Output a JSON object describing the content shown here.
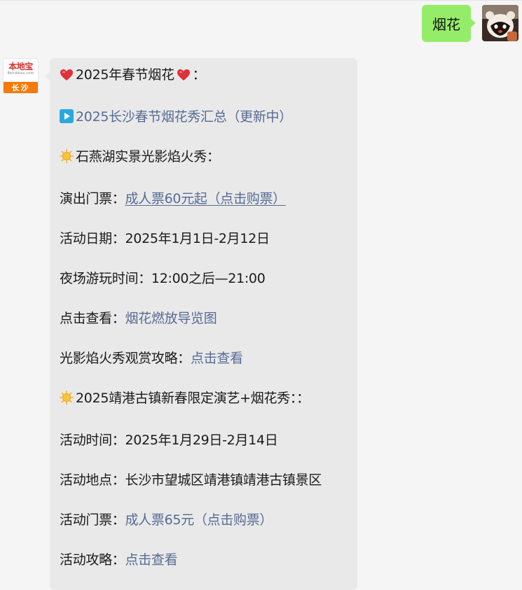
{
  "user_message": {
    "text": "烟花"
  },
  "bot": {
    "logo": {
      "brand": "本地宝",
      "url": "Bendibao.com",
      "city": "长沙"
    },
    "lines": {
      "l01_title": "2025年春节烟花",
      "l01_suffix": "：",
      "l02_link": "2025长沙春节烟花秀汇总（更新中）",
      "l03_heading": "石燕湖实景光影焰火秀：",
      "l04_label": "演出门票：",
      "l04_link": "成人票60元起（点击购票）",
      "l05_text": "活动日期：2025年1月1日-2月12日",
      "l06_text": "夜场游玩时间：12:00之后—21:00",
      "l07_label": "点击查看：",
      "l07_link": "烟花燃放导览图",
      "l08_label": "光影焰火秀观赏攻略：",
      "l08_link": "点击查看",
      "l09_heading": "2025靖港古镇新春限定演艺+烟花秀：：",
      "l10_text": "活动时间：2025年1月29日-2月14日",
      "l11_text": "活动地点：长沙市望城区靖港镇靖港古镇景区",
      "l12_label": "活动门票：",
      "l12_link": "成人票65元（点击购票）",
      "l13_label": "活动攻略：",
      "l13_link": "点击查看"
    }
  },
  "colors": {
    "page_bg": "#f5f5f5",
    "user_bubble": "#95ec69",
    "bot_bubble": "#e9e9e9",
    "link": "#576b95",
    "heart": "#e0303a",
    "sun": "#f5b21a",
    "play": "#29a9df"
  },
  "icons": {
    "heart": "red-heart-icon",
    "play": "play-button-icon",
    "sun": "sun-icon"
  }
}
